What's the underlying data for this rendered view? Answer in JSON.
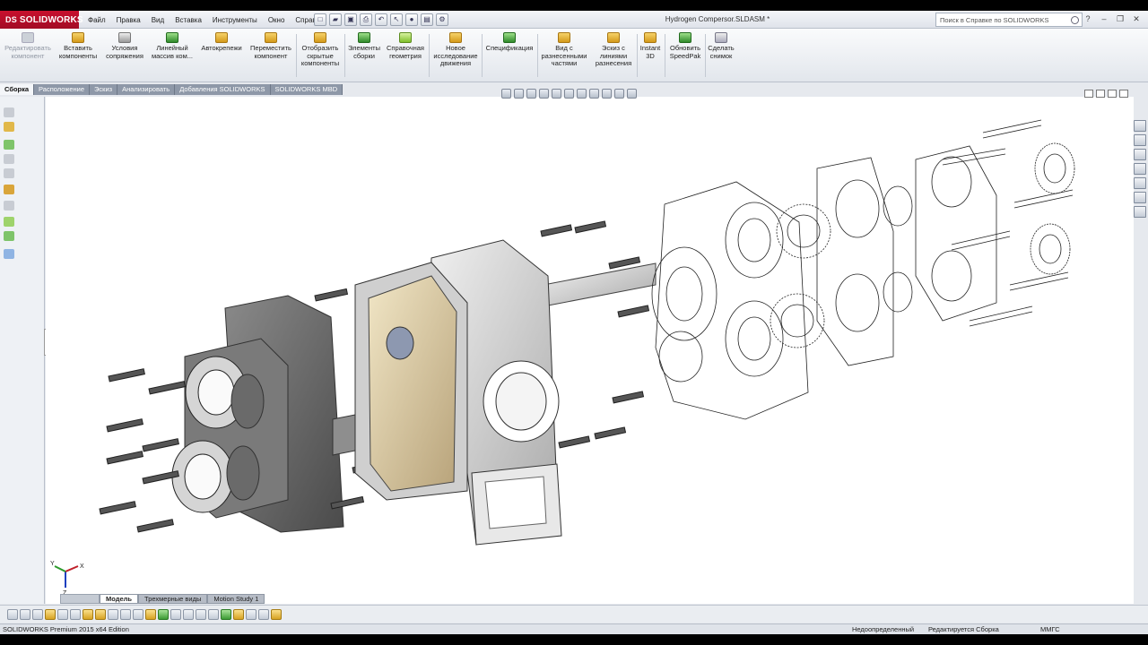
{
  "app": {
    "logo_text": "SOLIDWORKS",
    "logo_mark": "DS",
    "document_title": "Hydrogen Compersor.SLDASM *"
  },
  "menu": [
    "Файл",
    "Правка",
    "Вид",
    "Вставка",
    "Инструменты",
    "Окно",
    "Справка"
  ],
  "search": {
    "placeholder": "Поиск в Справке по SOLIDWORKS"
  },
  "command_manager": [
    {
      "label": "Редактировать компонент",
      "icon": "edit-component-icon",
      "disabled": true
    },
    {
      "label": "Вставить компоненты",
      "icon": "insert-components-icon"
    },
    {
      "label": "Условия сопряжения",
      "icon": "mate-icon"
    },
    {
      "label": "Линейный массив ком...",
      "icon": "linear-pattern-icon"
    },
    {
      "label": "Автокрепежи",
      "icon": "smart-fasteners-icon"
    },
    {
      "label": "Переместить компонент",
      "icon": "move-component-icon"
    },
    {
      "label": "Отобразить скрытые компоненты",
      "icon": "show-hidden-icon"
    },
    {
      "label": "Элементы сборки",
      "icon": "assembly-features-icon"
    },
    {
      "label": "Справочная геометрия",
      "icon": "reference-geometry-icon"
    },
    {
      "label": "Новое исследование движения",
      "icon": "motion-study-icon"
    },
    {
      "label": "Спецификация",
      "icon": "bom-icon"
    },
    {
      "label": "Вид с разнесенными частями",
      "icon": "exploded-view-icon"
    },
    {
      "label": "Эскиз с линиями разнесения",
      "icon": "explode-line-sketch-icon"
    },
    {
      "label": "Instant 3D",
      "icon": "instant3d-icon"
    },
    {
      "label": "Обновить SpeedPak",
      "icon": "speedpak-icon"
    },
    {
      "label": "Сделать снимок",
      "icon": "snapshot-icon"
    }
  ],
  "tabs": [
    "Сборка",
    "Расположение",
    "Эскиз",
    "Анализировать",
    "Добавления SOLIDWORKS",
    "SOLIDWORKS MBD"
  ],
  "bottom_tabs": [
    "Модель",
    "Трехмерные виды",
    "Motion Study 1"
  ],
  "status": {
    "edition": "SOLIDWORKS Premium 2015 x64 Edition",
    "definition": "Недоопределенный",
    "editing": "Редактируется Сборка",
    "units": "ММГС"
  },
  "triad": {
    "x": "X",
    "y": "Y",
    "z": "Z"
  }
}
